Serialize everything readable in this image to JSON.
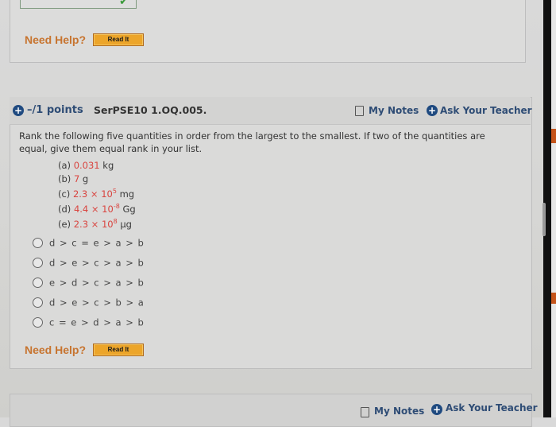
{
  "previous_question": {
    "need_help_label": "Need Help?",
    "read_it_label": "Read It",
    "answer_status_icon": "check-icon"
  },
  "question": {
    "points": "–/1 points",
    "id": "SerPSE10 1.OQ.005.",
    "my_notes_label": "My Notes",
    "ask_teacher_label": "Ask Your Teacher",
    "prompt": "Rank the following five quantities in order from the largest to the smallest. If two of the quantities are equal, give them equal rank in your list.",
    "quantities": [
      {
        "label": "(a)",
        "value": "0.031",
        "exp": "",
        "unit": "kg"
      },
      {
        "label": "(b)",
        "value": "7",
        "exp": "",
        "unit": "g"
      },
      {
        "label": "(c)",
        "value": "2.3 × 10",
        "exp": "5",
        "unit": "mg"
      },
      {
        "label": "(d)",
        "value": "4.4 × 10",
        "exp": "-8",
        "unit": "Gg"
      },
      {
        "label": "(e)",
        "value": "2.3 × 10",
        "exp": "8",
        "unit": "µg"
      }
    ],
    "options": [
      {
        "label": "d > c = e > a > b",
        "selected": false
      },
      {
        "label": "d > e > c > a > b",
        "selected": false
      },
      {
        "label": "e > d > c > a > b",
        "selected": false
      },
      {
        "label": "d > e > c > b > a",
        "selected": false
      },
      {
        "label": "c = e > d > a > b",
        "selected": false
      }
    ],
    "need_help_label": "Need Help?",
    "read_it_label": "Read It"
  },
  "next_question": {
    "my_notes_label": "My Notes",
    "ask_teacher_label": "Ask Your Teacher"
  },
  "colors": {
    "accent_blue": "#2e4c75",
    "help_orange": "#c7742f",
    "button_orange": "#eca52a",
    "value_red": "#d9443f"
  }
}
